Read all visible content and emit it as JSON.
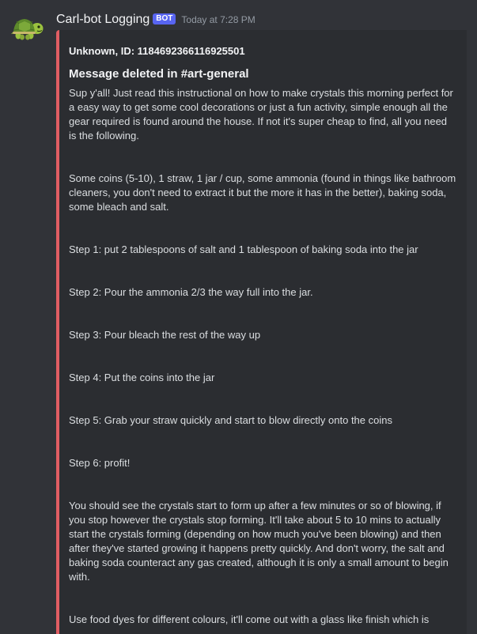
{
  "message": {
    "username": "Carl-bot Logging",
    "bot_tag": "BOT",
    "timestamp": "Today at 7:28 PM",
    "avatar_icon": "turtle-icon"
  },
  "embed": {
    "accent_color": "#e05d63",
    "author": "Unknown, ID: 1184692366116925501",
    "title": "Message deleted in #art-general",
    "paragraphs": [
      "Sup y'all! Just read this instructional on how to make crystals this morning perfect for a easy way to get some cool decorations or just a fun activity, simple enough all the gear required is found around the house. If not it's super cheap to find, all you need is the following.",
      "Some coins (5-10), 1 straw, 1 jar / cup, some ammonia (found in things like bathroom cleaners, you don't need to extract it but the more it has in the better), baking soda, some bleach and salt.",
      "Step 1: put 2 tablespoons of salt and 1 tablespoon of baking soda into the jar",
      "Step 2: Pour the ammonia 2/3 the way full into the jar.",
      "Step 3: Pour bleach the rest of the way up",
      "Step 4: Put the coins into the jar",
      "Step 5: Grab your straw quickly and start to blow directly onto the coins",
      "Step 6: profit!",
      "You should see the crystals start to form up after a few minutes or so of blowing, if you stop however the crystals stop forming. It'll take about 5 to 10 mins to actually start the crystals forming (depending on how much you've been blowing) and then after they've started growing it happens pretty quickly. And don't worry, the salt and baking soda counteract any gas created, although it is only a small amount to begin with.",
      "Use food dyes for different colours, it'll come out with a glass like finish which is"
    ]
  }
}
